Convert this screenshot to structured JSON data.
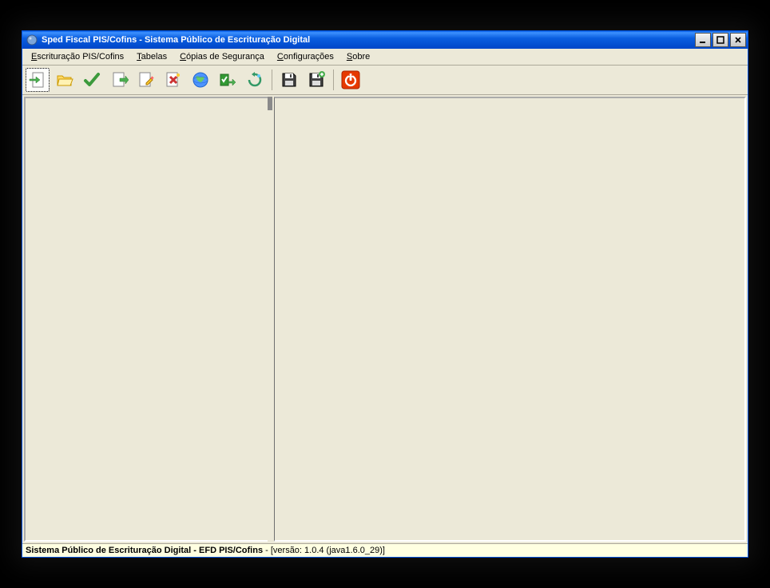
{
  "window": {
    "title": "Sped Fiscal PIS/Cofins - Sistema Público de Escrituração Digital"
  },
  "menubar": {
    "items": [
      {
        "label": "Escrituração PIS/Cofins",
        "mnemonic": "E"
      },
      {
        "label": "Tabelas",
        "mnemonic": "T"
      },
      {
        "label": "Cópias de Segurança",
        "mnemonic": "C"
      },
      {
        "label": "Configurações",
        "mnemonic": "C"
      },
      {
        "label": "Sobre",
        "mnemonic": "S"
      }
    ]
  },
  "toolbar": {
    "buttons": [
      {
        "name": "import-icon"
      },
      {
        "name": "open-folder-icon"
      },
      {
        "name": "check-icon"
      },
      {
        "name": "export-doc-icon"
      },
      {
        "name": "edit-pencil-icon"
      },
      {
        "name": "tools-cross-icon"
      },
      {
        "name": "globe-icon"
      },
      {
        "name": "check-config-icon"
      },
      {
        "name": "refresh-icon"
      },
      "sep",
      {
        "name": "save-icon"
      },
      {
        "name": "save-plus-icon"
      },
      "sep",
      {
        "name": "power-icon"
      }
    ]
  },
  "statusbar": {
    "bold": "Sistema Público de Escrituração Digital - EFD PIS/Cofins",
    "rest": " - [versão: 1.0.4 (java1.6.0_29)]"
  }
}
